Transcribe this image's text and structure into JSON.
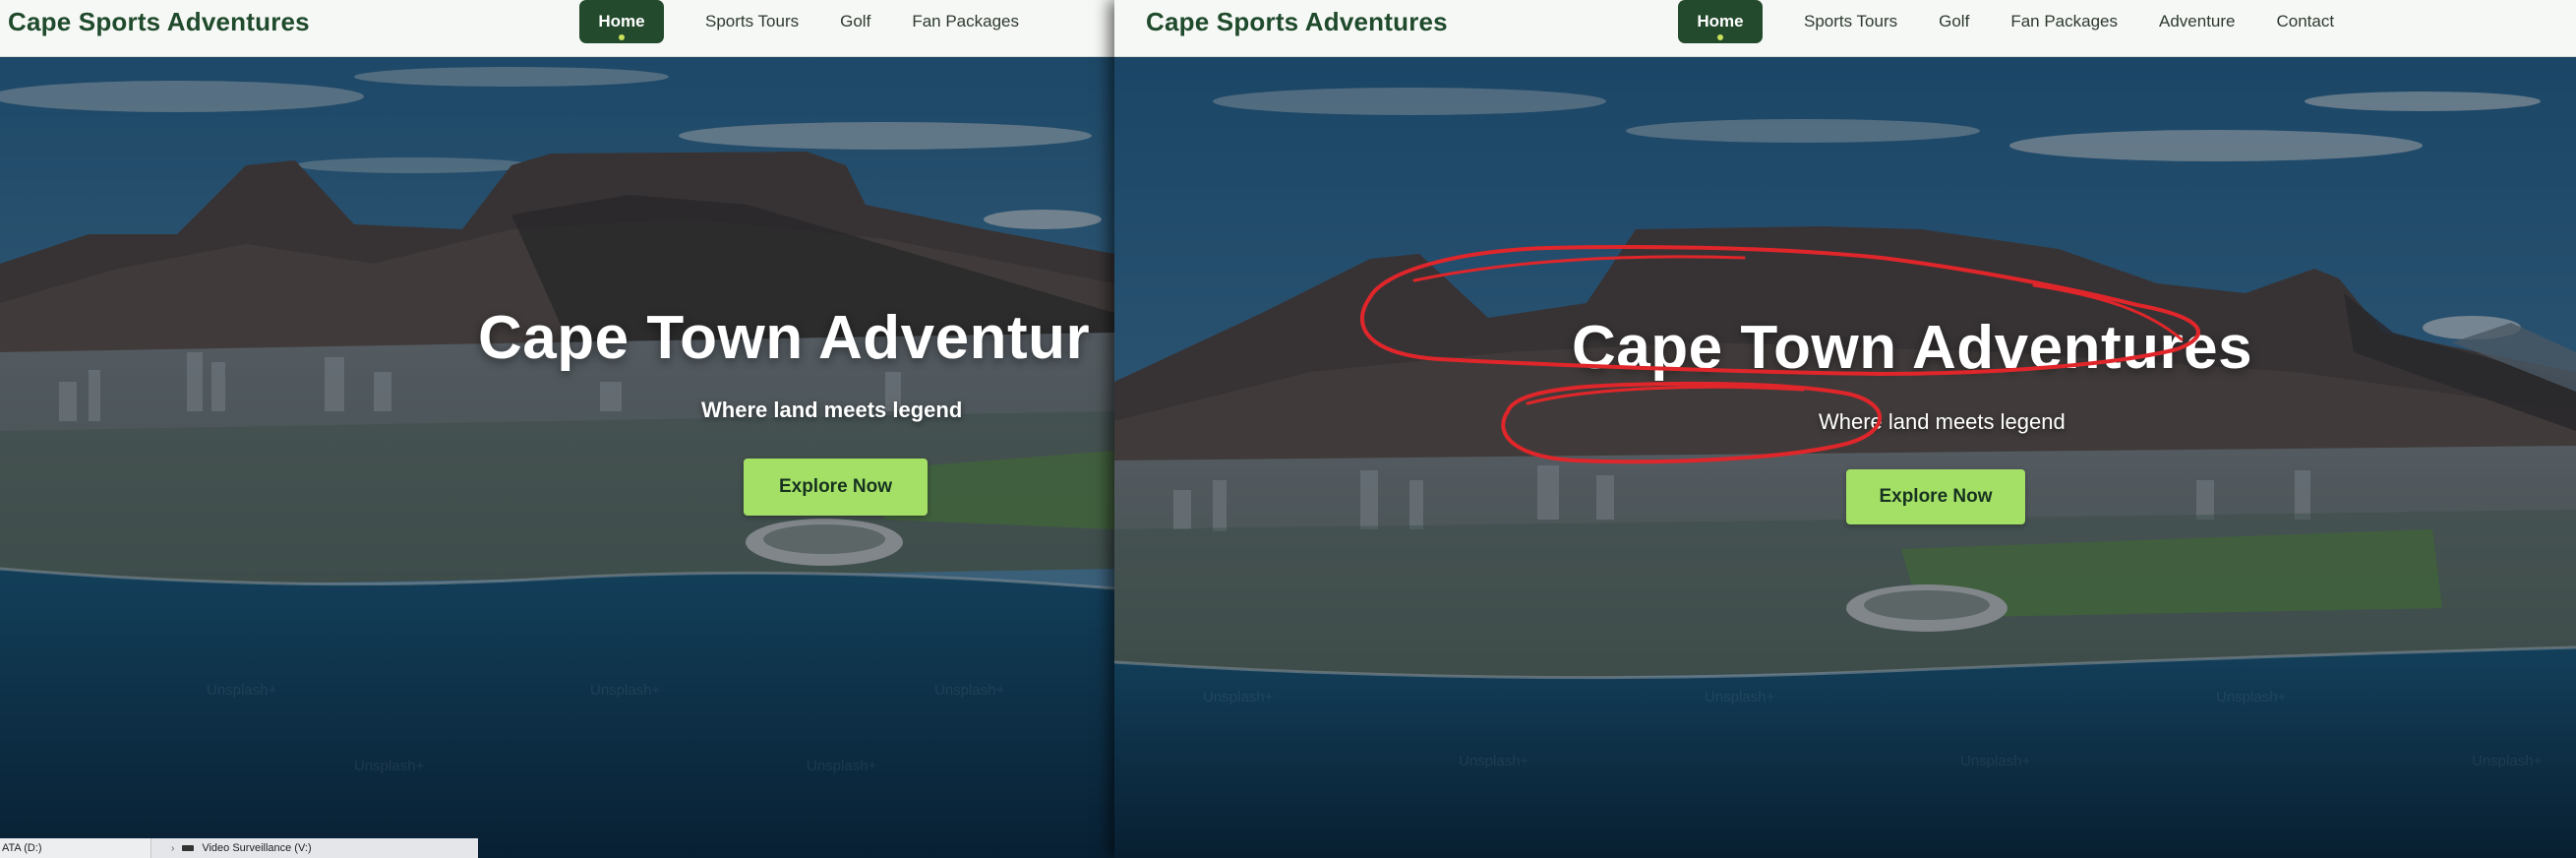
{
  "left_window": {
    "brand": "Cape Sports Adventures",
    "nav": [
      "Home",
      "Sports Tours",
      "Golf",
      "Fan Packages"
    ],
    "active_nav": "Home",
    "hero_title": "Cape Town Adventur",
    "hero_subtitle": "Where land meets legend",
    "cta_label": "Explore Now"
  },
  "right_window": {
    "brand": "Cape Sports Adventures",
    "nav": [
      "Home",
      "Sports Tours",
      "Golf",
      "Fan Packages",
      "Adventure",
      "Contact"
    ],
    "active_nav": "Home",
    "hero_title": "Cape Town Adventures",
    "hero_subtitle": "Where land meets legend",
    "cta_label": "Explore Now",
    "annotation_color": "#e0262a"
  },
  "watermark_text": "Unsplash+",
  "explorer_strip": {
    "left_drive": "ATA (D:)",
    "right_drive": "Video Surveillance (V:)"
  },
  "colors": {
    "brand_green": "#1f4a2c",
    "active_nav_bg": "#234a2d",
    "cta_bg": "#a4e065",
    "header_bg": "#f6f8f5"
  }
}
